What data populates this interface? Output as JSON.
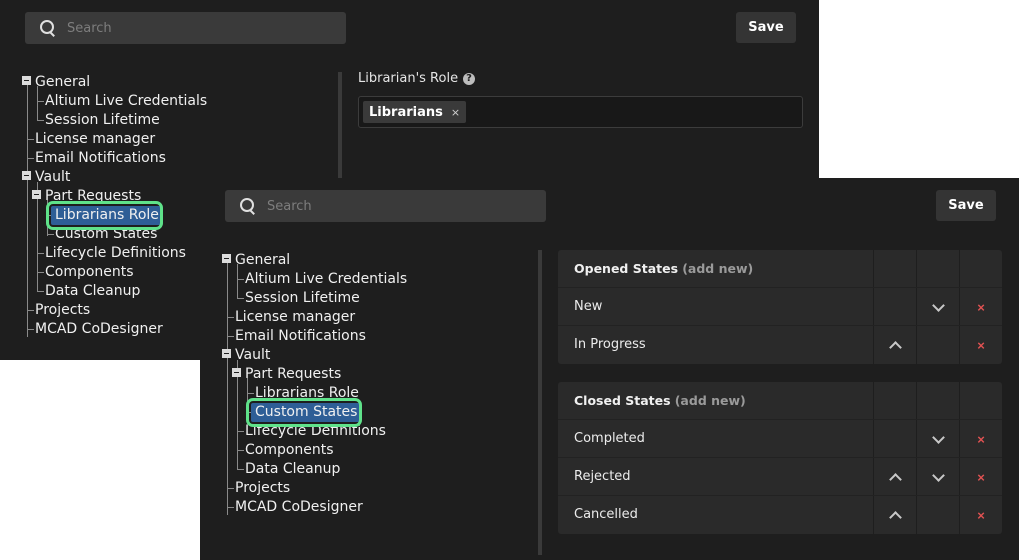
{
  "back_panel": {
    "search": {
      "placeholder": "Search"
    },
    "save_label": "Save",
    "tree": {
      "general": "General",
      "altium_live": "Altium Live Credentials",
      "session_lifetime": "Session Lifetime",
      "license_manager": "License manager",
      "email_notifications": "Email Notifications",
      "vault": "Vault",
      "part_requests": "Part Requests",
      "librarians_role": "Librarians Role",
      "custom_states": "Custom States",
      "lifecycle_definitions": "Lifecycle Definitions",
      "components": "Components",
      "data_cleanup": "Data Cleanup",
      "projects": "Projects",
      "mcad": "MCAD CoDesigner"
    },
    "librarian_role": {
      "label": "Librarian's Role",
      "help": "?",
      "chip": "Librarians",
      "chip_remove": "×"
    }
  },
  "front_panel": {
    "search": {
      "placeholder": "Search"
    },
    "save_label": "Save",
    "tree": {
      "general": "General",
      "altium_live": "Altium Live Credentials",
      "session_lifetime": "Session Lifetime",
      "license_manager": "License manager",
      "email_notifications": "Email Notifications",
      "vault": "Vault",
      "part_requests": "Part Requests",
      "librarians_role": "Librarians Role",
      "custom_states": "Custom States",
      "lifecycle_definitions": "Lifecycle Definitions",
      "components": "Components",
      "data_cleanup": "Data Cleanup",
      "projects": "Projects",
      "mcad": "MCAD CoDesigner"
    },
    "opened_states": {
      "title": "Opened States",
      "add_new": "(add new)",
      "rows": [
        "New",
        "In Progress"
      ]
    },
    "closed_states": {
      "title": "Closed States",
      "add_new": "(add new)",
      "rows": [
        "Completed",
        "Rejected",
        "Cancelled"
      ]
    },
    "remove_glyph": "×"
  },
  "colors": {
    "panel_bg": "#1e1e1e",
    "selection": "#2e5e96",
    "highlight_ring": "#5fe28a",
    "remove_red": "#e05252"
  }
}
